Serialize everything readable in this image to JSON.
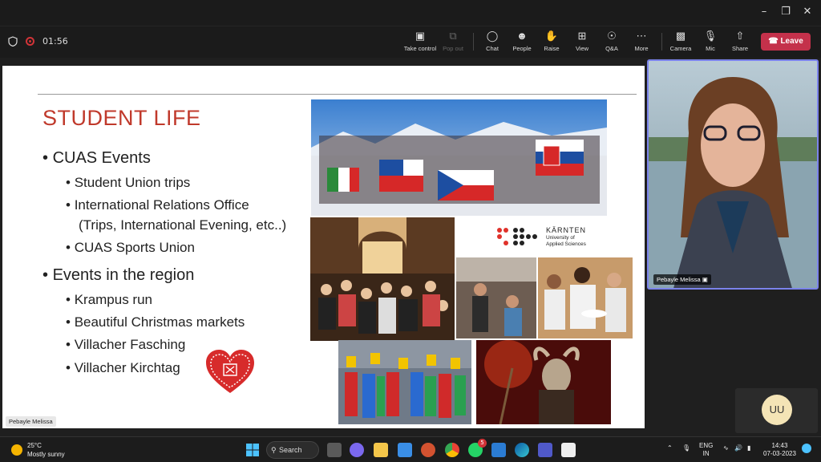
{
  "meeting": {
    "timer": "01:56",
    "toolbar": [
      {
        "label": "Take control",
        "icon": "take-control-icon",
        "enabled": true
      },
      {
        "label": "Pop out",
        "icon": "pop-out-icon",
        "enabled": false
      },
      {
        "label": "Chat",
        "icon": "chat-icon",
        "enabled": true
      },
      {
        "label": "People",
        "icon": "people-icon",
        "enabled": true
      },
      {
        "label": "Raise",
        "icon": "raise-hand-icon",
        "enabled": true
      },
      {
        "label": "View",
        "icon": "view-icon",
        "enabled": true
      },
      {
        "label": "Q&A",
        "icon": "qa-icon",
        "enabled": true
      },
      {
        "label": "More",
        "icon": "more-icon",
        "enabled": true
      },
      {
        "label": "Camera",
        "icon": "camera-off-icon",
        "enabled": true
      },
      {
        "label": "Mic",
        "icon": "mic-off-icon",
        "enabled": true
      },
      {
        "label": "Share",
        "icon": "share-icon",
        "enabled": true
      }
    ],
    "leave_label": "Leave",
    "presenter_label": "Pebayle Melissa",
    "participant_name": "Pebayle Melissa",
    "self_initials": "UU",
    "colors": {
      "leave": "#c4314b",
      "accent": "#7b83eb"
    }
  },
  "slide": {
    "title": "STUDENT LIFE",
    "title_color": "#c0392b",
    "bullets": [
      {
        "text": "CUAS Events",
        "level": 1
      },
      {
        "text": "Student Union trips",
        "level": 2
      },
      {
        "text": "International Relations Office",
        "level": 2
      },
      {
        "text": "(Trips, International Evening, etc..)",
        "level": 2
      },
      {
        "text": "CUAS Sports Union",
        "level": 2
      },
      {
        "text": "Events in the region",
        "level": 1
      },
      {
        "text": "Krampus run",
        "level": 2
      },
      {
        "text": "Beautiful Christmas markets",
        "level": 2
      },
      {
        "text": "Villacher Fasching",
        "level": 2
      },
      {
        "text": "Villacher Kirchtag",
        "level": 2
      }
    ],
    "logo": {
      "name": "KÄRNTEN",
      "line1": "University of",
      "line2": "Applied Sciences"
    }
  },
  "taskbar": {
    "weather_temp": "25°C",
    "weather_desc": "Mostly sunny",
    "search_label": "Search",
    "whatsapp_badge": "5",
    "lang_top": "ENG",
    "lang_bottom": "IN",
    "time": "14:43",
    "date": "07-03-2023"
  }
}
